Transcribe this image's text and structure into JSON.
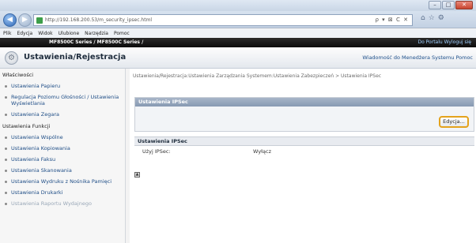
{
  "browser": {
    "url": "http://192.168.200.53/m_security_ipsec.html",
    "url_tools": "ρ ▾ ⊠ C ✕",
    "menu": [
      "Plik",
      "Edycja",
      "Widok",
      "Ulubione",
      "Narzędzia",
      "Pomoc"
    ]
  },
  "device_bar": {
    "device": "MF8500C Series / MF8500C Series /",
    "links": "Do Portalu  Wyloguj się"
  },
  "header": {
    "title": "Ustawienia/Rejestracja",
    "right_link": "Wiadomość do Menedżera Systemu  Pomoc"
  },
  "sidebar": {
    "group1": "Właściwości",
    "items1": [
      "Ustawienia Papieru",
      "Regulacja Poziomu Głośności / Ustawienia Wyświetlania",
      "Ustawienia Zegara"
    ],
    "group2": "Ustawienia Funkcji",
    "items2": [
      "Ustawienia Wspólne",
      "Ustawienia Kopiowania",
      "Ustawienia Faksu",
      "Ustawienia Skanowania",
      "Ustawienia Wydruku z Nośnika Pamięci",
      "Ustawienia Drukarki",
      "Ustawienia Raportu Wydajnego"
    ]
  },
  "main": {
    "breadcrumb": "Ustawienia/Rejestracja:Ustawienia Zarządzania Systemem:Ustawienia Zabezpieczeń > Ustawienia IPSec",
    "section_title": "Ustawienia IPSec",
    "edit_label": "Edycja...",
    "sub_title": "Ustawienia IPSec",
    "row_label": "Użyj IPSec:",
    "row_value": "Wyłącz"
  }
}
